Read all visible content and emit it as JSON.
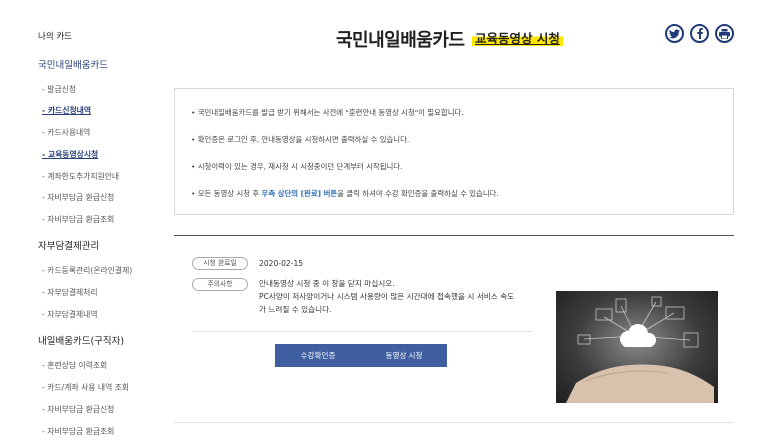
{
  "sidebar": {
    "title": "나의 카드",
    "sections": [
      {
        "label": "국민내일배움카드",
        "items": [
          {
            "label": "발급신청",
            "active": false
          },
          {
            "label": "카드신청내역",
            "active": true
          },
          {
            "label": "카드사용내역",
            "active": false
          },
          {
            "label": "교육동영상시청",
            "active": true
          },
          {
            "label": "계좌한도추가지원안내",
            "active": false
          },
          {
            "label": "자비부담금 환급신청",
            "active": false
          },
          {
            "label": "자비부담금 환급조회",
            "active": false
          }
        ]
      },
      {
        "label": "자부담결제관리",
        "items": [
          {
            "label": "카드등록관리(온라인결제)",
            "active": false
          },
          {
            "label": "자부담결제처리",
            "active": false
          },
          {
            "label": "자부담결제내역",
            "active": false
          }
        ]
      },
      {
        "label": "내일배움카드(구직자)",
        "items": [
          {
            "label": "훈련상담 이력조회",
            "active": false
          },
          {
            "label": "카드/계좌 사용 내역 조회",
            "active": false
          },
          {
            "label": "자비부담금 환급신청",
            "active": false
          },
          {
            "label": "자비부담금 환급조회",
            "active": false
          }
        ]
      }
    ]
  },
  "header": {
    "title": "국민내일배움카드",
    "subtitle": "교육동영상 시청",
    "share_icons": [
      "twitter-icon",
      "facebook-icon",
      "print-icon"
    ],
    "accent_color": "#203a78",
    "highlight_color": "#ffe600"
  },
  "notice": {
    "items": [
      {
        "text": "국민내일배움카드를 발급 받기 위해서는 사전에 \"훈련안내 동영상 시청\"이 필요합니다.",
        "highlight": "",
        "text_after": ""
      },
      {
        "text": "확인증은 로그인 후, 안내동영상을 시청하시면 출력하실 수 있습니다.",
        "highlight": "",
        "text_after": ""
      },
      {
        "text": "시청이력이 있는 경우, 재시청 시 시청중이던 단계부터 시작됩니다.",
        "highlight": "",
        "text_after": ""
      },
      {
        "text": "모든 동영상 시청 후 ",
        "highlight": "우측 상단의 [완료] 버튼",
        "text_after": "을 클릭 하셔야 수강 확인증을 출력하실 수 있습니다."
      }
    ]
  },
  "info": {
    "completed_label": "시청 완료일",
    "completed_date": "2020-02-15",
    "caution_label": "주의사항",
    "caution_lines": [
      "안내동영상 시청 중 이 창을 닫지 마십시오.",
      "PC사양이 저사양이거나 시스템 사용량이 많은 시간대에 접속했을 시 서비스 속도",
      "가 느려질 수 있습니다."
    ]
  },
  "buttons": {
    "certificate": "수강확인증",
    "watch": "동영상 시청",
    "color": "#3f5fa0"
  }
}
